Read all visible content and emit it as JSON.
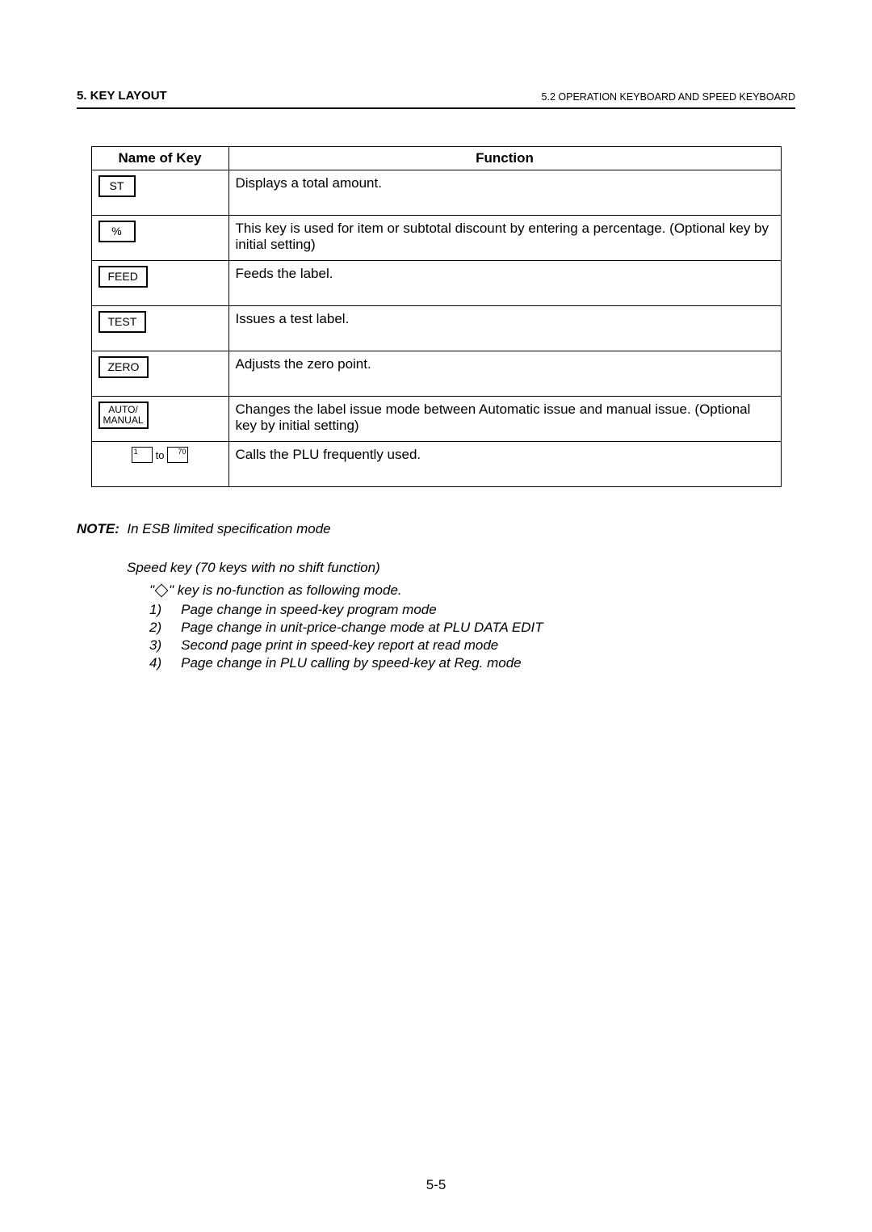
{
  "header": {
    "section_title": "5.  KEY LAYOUT",
    "section_sub": "5.2 OPERATION KEYBOARD AND SPEED KEYBOARD"
  },
  "table": {
    "col_name": "Name of Key",
    "col_func": "Function",
    "rows": [
      {
        "key": "ST",
        "func": "Displays a total amount."
      },
      {
        "key": "%",
        "func": "This key is used for item or subtotal discount by entering a percentage. (Optional key by initial setting)"
      },
      {
        "key": "FEED",
        "func": "Feeds the label."
      },
      {
        "key": "TEST",
        "func": "Issues a test label."
      },
      {
        "key": "ZERO",
        "func": "Adjusts the zero point."
      },
      {
        "key": "AUTO/\nMANUAL",
        "func": "Changes the label issue mode between Automatic issue and manual issue.  (Optional key by initial setting)"
      },
      {
        "key_range_from": "1",
        "key_range_to": "70",
        "to_word": "to",
        "func": "Calls the PLU frequently used."
      }
    ]
  },
  "note": {
    "label": "NOTE:",
    "intro": "In ESB limited specification mode",
    "speed_line": "Speed key (70 keys with no shift function)",
    "diamond_prefix": "\"",
    "diamond_suffix": "\" key is no-function as following mode.",
    "items": [
      {
        "n": "1)",
        "t": "Page change in speed-key program mode"
      },
      {
        "n": "2)",
        "t": "Page change in unit-price-change mode at PLU DATA EDIT"
      },
      {
        "n": "3)",
        "t": "Second page print in speed-key report at read mode"
      },
      {
        "n": "4)",
        "t": "Page change in PLU calling by speed-key at Reg. mode"
      }
    ]
  },
  "page_number": "5-5"
}
